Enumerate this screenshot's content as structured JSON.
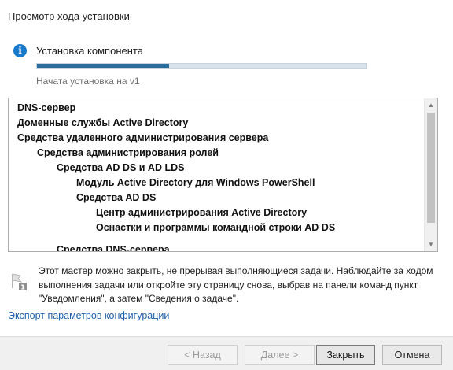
{
  "header": {
    "title": "Просмотр хода установки"
  },
  "progress": {
    "label": "Установка компонента",
    "status": "Начата установка на v1",
    "fraction": 0.4,
    "fill_color": "#2a6d9b",
    "icon": "info-icon"
  },
  "features": [
    {
      "label": "DNS-сервер",
      "level": 0,
      "bold": true
    },
    {
      "label": "Доменные службы Active Directory",
      "level": 0,
      "bold": true
    },
    {
      "label": "Средства удаленного администрирования сервера",
      "level": 0,
      "bold": true
    },
    {
      "label": "Средства администрирования ролей",
      "level": 1,
      "bold": true
    },
    {
      "label": "Средства AD DS и AD LDS",
      "level": 2,
      "bold": true
    },
    {
      "label": "Модуль Active Directory для Windows PowerShell",
      "level": 3,
      "bold": true
    },
    {
      "label": "Средства AD DS",
      "level": 3,
      "bold": true
    },
    {
      "label": "Центр администрирования Active Directory",
      "level": 4,
      "bold": true
    },
    {
      "label": "Оснастки и программы командной строки AD DS",
      "level": 4,
      "bold": true
    },
    {
      "label": "Средства DNS-сервера",
      "level": 2,
      "bold": true
    }
  ],
  "note": {
    "text": "Этот мастер можно закрыть, не прерывая выполняющиеся задачи. Наблюдайте за ходом выполнения задачи или откройте эту страницу снова, выбрав на панели команд пункт \"Уведомления\", а затем \"Сведения о задаче\".",
    "icon": "flag-notification-icon"
  },
  "links": {
    "export": "Экспорт параметров конфигурации"
  },
  "buttons": {
    "back": "< Назад",
    "next": "Далее >",
    "close": "Закрыть",
    "cancel": "Отмена"
  },
  "colors": {
    "accent": "#1979ca",
    "link": "#1f62ad"
  }
}
